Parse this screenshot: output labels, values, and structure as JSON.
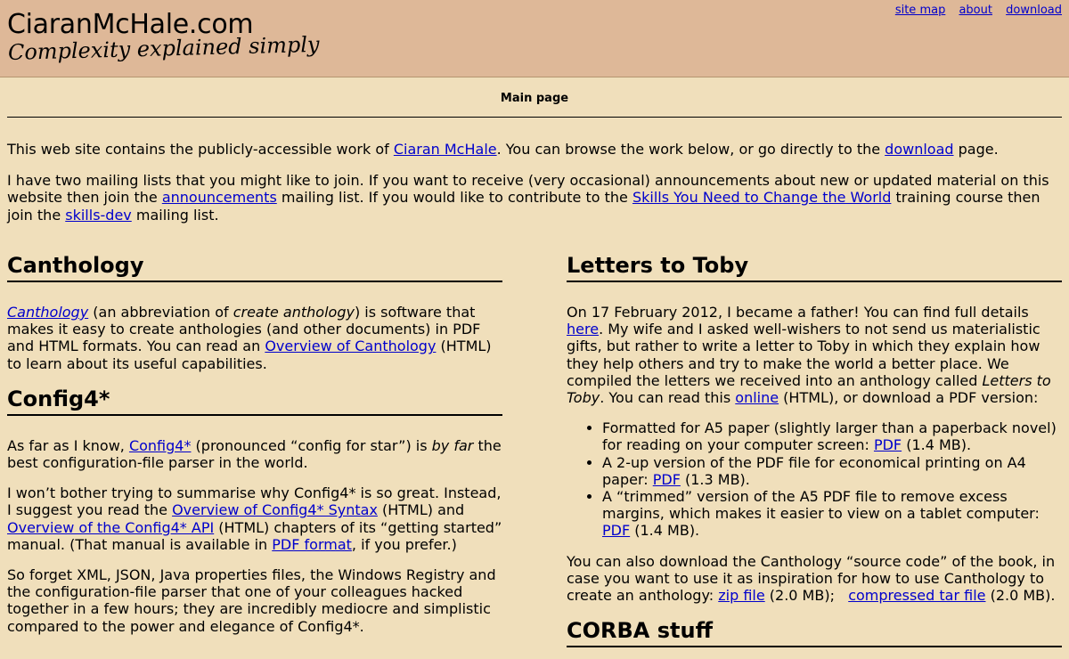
{
  "header": {
    "site_name": "CiaranMcHale.com",
    "tagline": "Complexity explained simply",
    "nav": {
      "site_map": "site map",
      "about": "about",
      "download": "download"
    }
  },
  "page_title": "Main page",
  "intro": {
    "p1_a": "This web site contains the publicly-accessible work of ",
    "p1_link1": "Ciaran McHale",
    "p1_b": ". You can browse the work below, or go directly to the ",
    "p1_link2": "download",
    "p1_c": " page.",
    "p2_a": "I have two mailing lists that you might like to join. If you want to receive (very occasional) announcements about new or updated material on this website then join the ",
    "p2_link1": "announcements",
    "p2_b": " mailing list. If you would like to contribute to the ",
    "p2_link2": "Skills You Need to Change the World",
    "p2_c": " training course then join the ",
    "p2_link3": "skills-dev",
    "p2_d": " mailing list."
  },
  "canthology": {
    "heading": "Canthology",
    "link": "Canthology",
    "t1": " (an abbreviation of ",
    "em": "create anthology",
    "t2": ") is software that makes it easy to create anthologies (and other documents) in PDF and HTML formats. You can read an ",
    "link2": "Overview of Canthology",
    "t3": " (HTML) to learn about its useful capabilities."
  },
  "config4": {
    "heading": "Config4*",
    "p1_a": "As far as I know, ",
    "p1_link": "Config4*",
    "p1_b": " (pronounced “config for star”) is ",
    "p1_em": "by far",
    "p1_c": " the best configuration-file parser in the world.",
    "p2_a": "I won’t bother trying to summarise why Config4* is so great. Instead, I suggest you read the ",
    "p2_link1": "Overview of Config4* Syntax",
    "p2_b": " (HTML) and ",
    "p2_link2": "Overview of the Config4* API",
    "p2_c": " (HTML) chapters of its “getting started” manual. (That manual is available in ",
    "p2_link3": "PDF format",
    "p2_d": ", if you prefer.)",
    "p3": "So forget XML, JSON, Java properties files, the Windows Registry and the configuration-file parser that one of your colleagues hacked together in a few hours; they are incredibly mediocre and simplistic compared to the power and elegance of Config4*."
  },
  "toby": {
    "heading": "Letters to Toby",
    "p1_a": "On 17 February 2012, I became a father! You can find full details ",
    "p1_link1": "here",
    "p1_b": ". My wife and I asked well-wishers to not send us materialistic gifts, but rather to write a letter to Toby in which they explain how they help others and try to make the world a better place. We compiled the letters we received into an anthology called ",
    "p1_em": "Letters to Toby",
    "p1_c": ". You can read this ",
    "p1_link2": "online",
    "p1_d": " (HTML), or download a PDF version:",
    "items": [
      {
        "text": "Formatted for A5 paper (slightly larger than a paperback novel) for reading on your computer screen: ",
        "link": "PDF",
        "size": " (1.4 MB)."
      },
      {
        "text": "A 2-up version of the PDF file for economical printing on A4 paper: ",
        "link": "PDF",
        "size": " (1.3 MB)."
      },
      {
        "text": "A “trimmed” version of the A5 PDF file to remove excess margins, which makes it easier to view on a tablet computer: ",
        "link": "PDF",
        "size": " (1.4 MB)."
      }
    ],
    "p2_a": "You can also download the Canthology “source code” of the book, in case you want to use it as inspiration for how to use Canthology to create an anthology: ",
    "p2_link1": "zip file",
    "p2_b": " (2.0 MB);   ",
    "p2_link2": "compressed tar file",
    "p2_c": " (2.0 MB)."
  },
  "corba": {
    "heading": "CORBA stuff"
  }
}
